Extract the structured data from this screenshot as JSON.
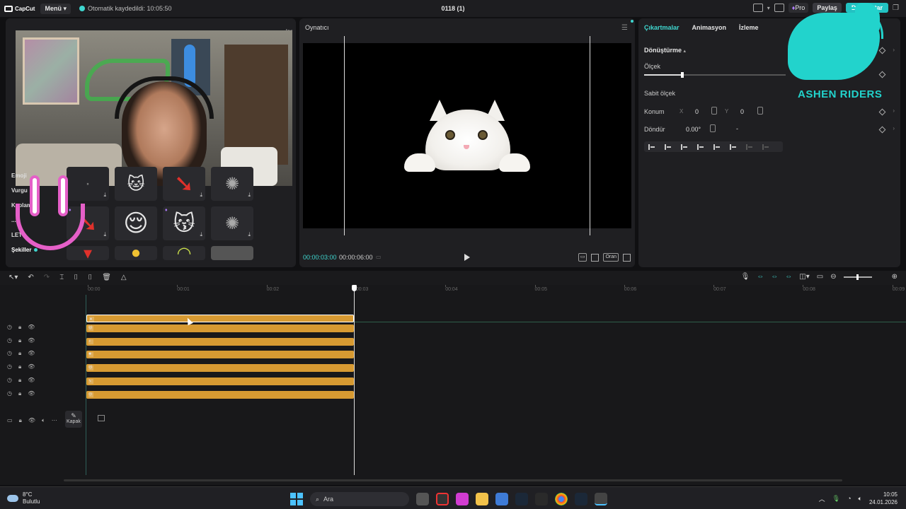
{
  "titlebar": {
    "app_name": "CapCut",
    "menu_label": "Menü",
    "autosave": "Otomatik kaydedildi: 10:05:50",
    "project_title": "0118 (1)",
    "pro_label": "Pro",
    "share_label": "Paylaş",
    "export_label": "Dışa Aktar",
    "accent": "#22c2c2"
  },
  "left": {
    "partial_tab": "lar",
    "categories": [
      "Emoji",
      "Vurgu",
      "Kaplam",
      "...",
      "LET",
      "Şekiller"
    ],
    "stickers": [
      {
        "icon": "sparkle-icon",
        "glyph": "·",
        "pro": false
      },
      {
        "icon": "cat-icon",
        "glyph": "🐱",
        "pro": false
      },
      {
        "icon": "red-arrow-icon",
        "glyph": "➘",
        "pro": false
      },
      {
        "icon": "dust-icon",
        "glyph": "✺",
        "pro": false
      },
      {
        "icon": "red-arrow-icon",
        "glyph": "➘",
        "pro": true
      },
      {
        "icon": "emoji-icon",
        "glyph": "😌",
        "pro": false
      },
      {
        "icon": "cat-hands-icon",
        "glyph": "😽",
        "pro": true
      },
      {
        "icon": "dust-icon",
        "glyph": "✺",
        "pro": false
      }
    ]
  },
  "player": {
    "title": "Oynatıcı",
    "current_time": "00:00:03:00",
    "total_time": "00:00:06:00",
    "ratio_label": "Oran"
  },
  "right": {
    "tabs": [
      "Çıkartmalar",
      "Animasyon",
      "İzleme"
    ],
    "section": "Dönüştürme",
    "scale_label": "Ölçek",
    "scale_level": 0.27,
    "uniform_scale_label": "Sabit ölçek",
    "position_label": "Konum",
    "x_label": "X",
    "x_value": "0",
    "y_label": "Y",
    "y_value": "0",
    "rotate_label": "Döndür",
    "rotate_value": "0.00°",
    "rotate_dash": "-"
  },
  "overlay": {
    "logo_text": "ASHEN RIDERS"
  },
  "timeline": {
    "ticks": [
      "00:00",
      "00:01",
      "00:02",
      "00:03",
      "00:04",
      "00:05",
      "00:06",
      "00:07",
      "00:08",
      "00:09"
    ],
    "cover_label": "Kapak",
    "clip_count": 7
  },
  "taskbar": {
    "temperature": "8°C",
    "weather": "Bulutlu",
    "search_placeholder": "Ara",
    "time": "10:05",
    "date": "24.01.2026"
  }
}
